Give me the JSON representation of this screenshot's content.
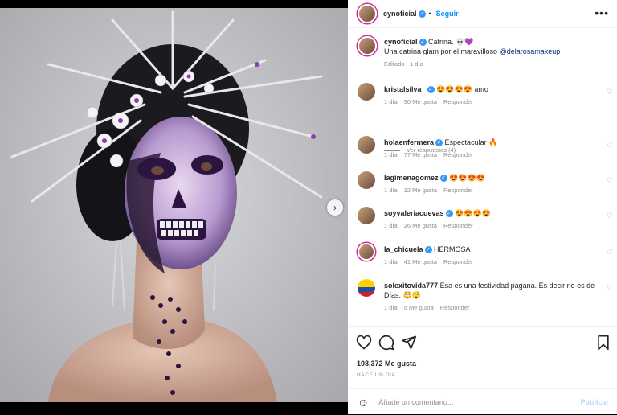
{
  "post": {
    "username": "cynoficial",
    "follow_label": "Seguir",
    "dot": "•",
    "more_label": "•••",
    "caption_text": "Catrina. 💀💜",
    "caption_line2": "Una catrina glam por el maravilloso",
    "caption_mention": "@delarosamakeup",
    "edited": "Editado",
    "caption_time": "1 día"
  },
  "comments": [
    {
      "user": "kristalsilva_",
      "text": "😍😍😍😍 amo",
      "time": "1 día",
      "likes": "90 Me gusta",
      "reply": "Responder"
    },
    {
      "user": "holaenfermera",
      "text": "Espectacular 🔥",
      "time": "1 día",
      "likes": "77 Me gusta",
      "reply": "Responder"
    },
    {
      "user": "lagimenagomez",
      "text": "😍😍😍😍",
      "time": "1 día",
      "likes": "32 Me gusta",
      "reply": "Responder"
    },
    {
      "user": "soyvaleriacuevas",
      "text": "😍😍😍😍",
      "time": "1 día",
      "likes": "26 Me gusta",
      "reply": "Responder"
    },
    {
      "user": "la_chicuela",
      "text": "HERMOSA",
      "time": "1 día",
      "likes": "41 Me gusta",
      "reply": "Responder"
    },
    {
      "user": "solexitovida777",
      "text": "Esa es una festividad pagana. Es decir no es de Días. 😳😲",
      "time": "1 día",
      "likes": "5 Me gusta",
      "reply": "Responder"
    }
  ],
  "view_replies": "Ver respuestas (4)",
  "likes_count": "108,372 Me gusta",
  "time_ago": "HACE UN DÍA",
  "add_comment": {
    "emoji": "☺",
    "placeholder": "Añade un comentario...",
    "publish": "Publicar"
  },
  "icons": [
    "heart-icon",
    "comment-icon",
    "share-icon",
    "bookmark-icon",
    "chevron-right-icon",
    "verified-icon",
    "emoji-icon"
  ],
  "colors": {
    "accent": "#0095f6",
    "verified": "#3897f0",
    "ring": "#d6249f",
    "publish_disabled": "#b3dbff"
  }
}
